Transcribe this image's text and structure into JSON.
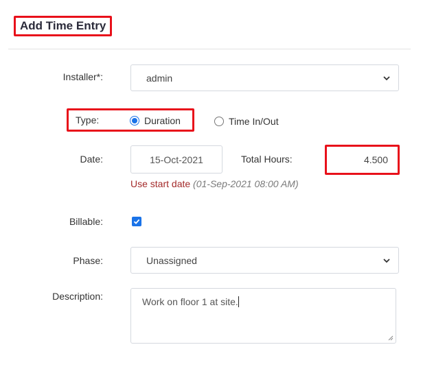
{
  "header": {
    "title": "Add Time Entry"
  },
  "form": {
    "installer": {
      "label": "Installer*:",
      "value": "admin"
    },
    "type": {
      "label": "Type:",
      "options": [
        {
          "label": "Duration",
          "selected": true
        },
        {
          "label": "Time In/Out",
          "selected": false
        }
      ]
    },
    "date": {
      "label": "Date:",
      "value": "15-Oct-2021"
    },
    "total_hours": {
      "label": "Total Hours:",
      "value": "4.500"
    },
    "use_start_date": {
      "link": "Use start date",
      "detail": "(01-Sep-2021 08:00 AM)"
    },
    "billable": {
      "label": "Billable:",
      "checked": true
    },
    "phase": {
      "label": "Phase:",
      "value": "Unassigned"
    },
    "description": {
      "label": "Description:",
      "value": "Work on floor 1 at site."
    }
  },
  "colors": {
    "highlight": "#e8101a",
    "accent": "#1a73e8",
    "hint": "#a32a2a"
  }
}
